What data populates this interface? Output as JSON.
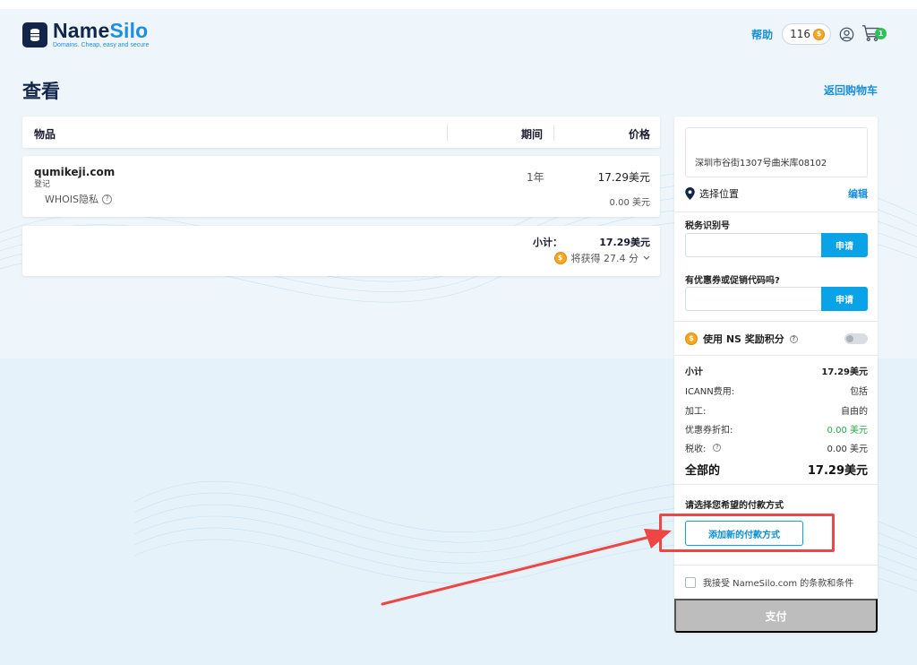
{
  "header": {
    "brand_name_a": "Name",
    "brand_name_b": "Silo",
    "brand_tagline": "Domains. Cheap, easy and secure",
    "help": "帮助",
    "points": "116",
    "cart_count": "1"
  },
  "page": {
    "title": "查看",
    "back_to_cart": "返回购物车"
  },
  "items_table": {
    "col_item": "物品",
    "col_period": "期间",
    "col_price": "价格"
  },
  "item": {
    "domain": "qumikeji.com",
    "type": "登记",
    "whois": "WHOIS隐私",
    "period": "1年",
    "price": "17.29美元",
    "whois_price": "0.00 美元"
  },
  "subtotal": {
    "label": "小计：",
    "value": "17.29美元",
    "earn": "将获得 27.4 分"
  },
  "sidebar": {
    "address": "深圳市谷街1307号曲米库08102",
    "choose_location": "选择位置",
    "edit": "编辑",
    "tax_id_label": "税务识别号",
    "tax_id_placeholder": "",
    "apply": "申请",
    "coupon_label": "有优惠券或促销代码吗?",
    "coupon_placeholder": "",
    "apply2": "申请",
    "use_rewards": "使用 NS 奖励积分",
    "summary": {
      "subtotal_l": "小计",
      "subtotal_v": "17.29美元",
      "icann_l": "ICANN费用:",
      "icann_v": "包括",
      "processing_l": "加工:",
      "processing_v": "自由的",
      "coupon_l": "优惠券折扣:",
      "coupon_v": "0.00 美元",
      "tax_l": "税收:",
      "tax_v": "0.00 美元",
      "total_l": "全部的",
      "total_v": "17.29美元"
    },
    "pay_method_label": "请选择您希望的付款方式",
    "add_pay_method": "添加新的付款方式",
    "terms": "我接受 NameSilo.com 的条款和条件",
    "pay": "支付"
  },
  "colors": {
    "brand_dark": "#12254a",
    "brand_blue": "#1f8de0",
    "link": "#1a8fd8",
    "apply_button": "#0aa3e8",
    "highlight": "#ee4545",
    "discount": "#2ba84a",
    "pay_disabled": "#bdbdbd"
  }
}
